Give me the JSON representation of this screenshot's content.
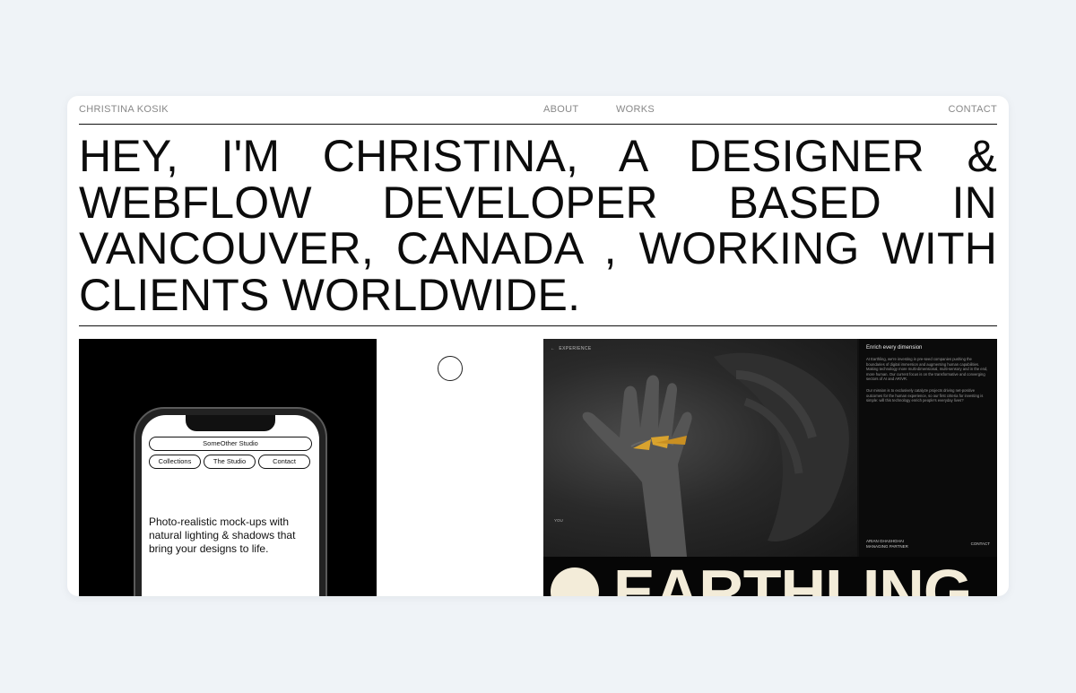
{
  "nav": {
    "logo": "CHRISTINA KOSIK",
    "about": "ABOUT",
    "works": "WORKS",
    "contact": "CONTACT"
  },
  "hero": {
    "text": "HEY, I'M CHRISTINA, A DESIGNER & WEBFLOW DEVELOPER BASED IN VANCOUVER, CANADA , WORKING WITH CLIENTS WORLDWIDE."
  },
  "project_left": {
    "studio_name": "SomeOther Studio",
    "menu": [
      "Collections",
      "The Studio",
      "Contact"
    ],
    "tagline": "Photo-realistic mock-ups with natural lighting & shadows that bring your designs to life."
  },
  "project_right": {
    "nav_label": "EXPERIENCE",
    "side_title": "Enrich every dimension",
    "side_para1": "At Earthling, we're investing in pre-seed companies pushing the boundaries of digital immersion and augmenting human capabilities. Making technology more multi-dimensional, multi-sensory and in the end, more human. Our current focus is on the transformative and converging sectors of AI and AR/VR.",
    "side_para2": "Our mission is to exclusively catalyze projects driving net-positive outcomes for the human experience, so our first criteria for investing is simple: will this technology enrich people's everyday lives?",
    "you_label": "YOU",
    "person_name": "ARIAN GHASHGHAI",
    "person_role": "MANAGING PARTNER",
    "contact": "CONTACT",
    "brand": "EARTHLING"
  },
  "colors": {
    "page_bg": "#eff3f7",
    "card_bg": "#ffffff",
    "ink": "#0c0c0c",
    "cream": "#f3ecd9",
    "butterfly": "#d9a32e"
  }
}
